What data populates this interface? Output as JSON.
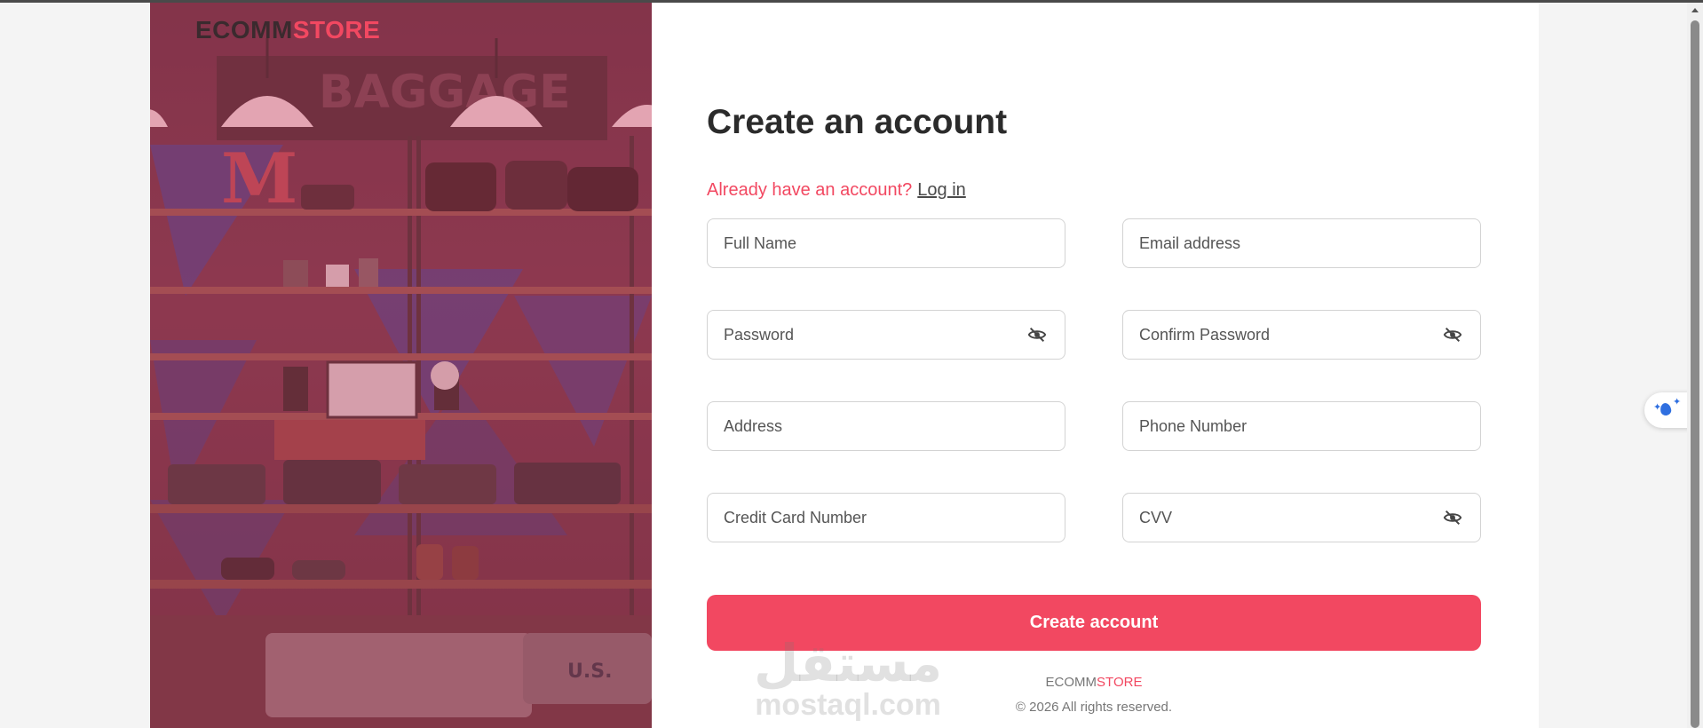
{
  "brand": {
    "part1": "ECOMM",
    "part2": "STORE"
  },
  "form": {
    "title": "Create an account",
    "already_text": "Already have an account?",
    "login_link": "Log in",
    "fields": {
      "full_name": "Full Name",
      "email": "Email address",
      "password": "Password",
      "confirm_password": "Confirm Password",
      "address": "Address",
      "phone": "Phone Number",
      "credit_card": "Credit Card Number",
      "cvv": "CVV"
    },
    "submit_label": "Create account"
  },
  "footer": {
    "brand_part1": "ECOMM",
    "brand_part2": "STORE",
    "copyright": "© 2026 All rights reserved."
  },
  "watermark": {
    "arabic": "مستقل",
    "latin": "mostaql.com"
  },
  "colors": {
    "accent": "#f24861",
    "heading": "#2b2b2b",
    "border": "#d3d3d3"
  },
  "icons": {
    "password_toggle": "eye-off-icon",
    "assistant": "water-drop-sparkle-icon"
  }
}
